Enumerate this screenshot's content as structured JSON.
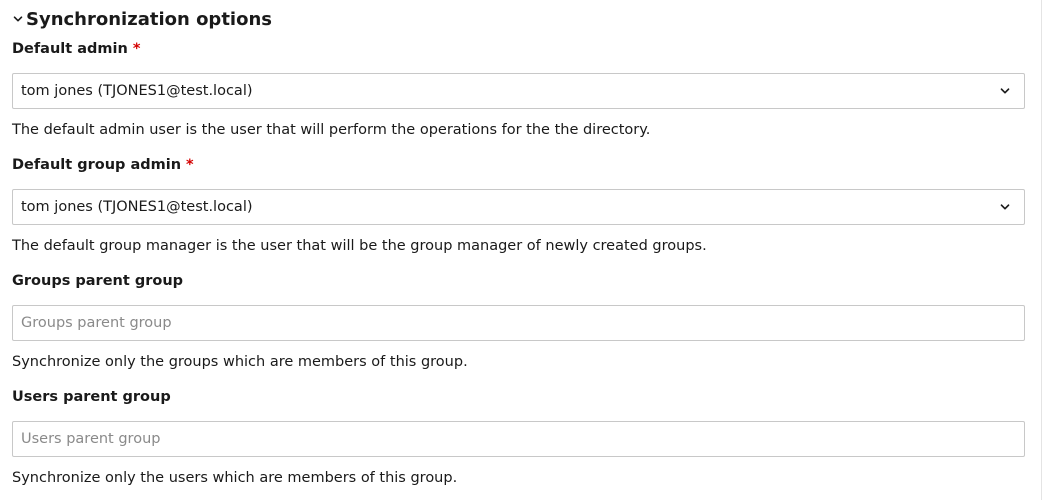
{
  "section": {
    "title": "Synchronization options",
    "chevron_icon": "chevron-down-icon",
    "expanded": true
  },
  "fields": {
    "default_admin": {
      "label": "Default admin",
      "required_marker": "*",
      "value": "tom jones (TJONES1@test.local)",
      "help": "The default admin user is the user that will perform the operations for the the directory."
    },
    "default_group_admin": {
      "label": "Default group admin",
      "required_marker": "*",
      "value": "tom jones (TJONES1@test.local)",
      "help": "The default group manager is the user that will be the group manager of newly created groups."
    },
    "groups_parent_group": {
      "label": "Groups parent group",
      "placeholder": "Groups parent group",
      "help": "Synchronize only the groups which are members of this group."
    },
    "users_parent_group": {
      "label": "Users parent group",
      "placeholder": "Users parent group",
      "help": "Synchronize only the users which are members of this group."
    }
  },
  "colors": {
    "required": "#d40101",
    "border": "#c8c8c8",
    "text": "#1a1a1a",
    "placeholder": "#8a8a8a"
  }
}
